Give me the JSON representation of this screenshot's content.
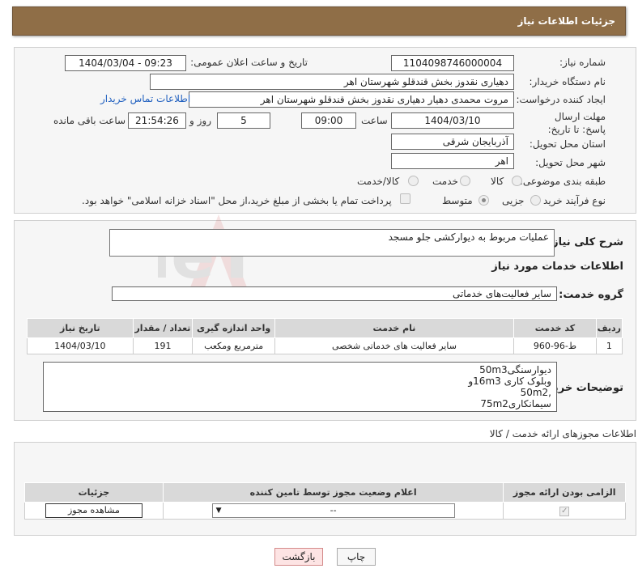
{
  "header": {
    "title": "جزئیات اطلاعات نیاز"
  },
  "form": {
    "need_number_label": "شماره نیاز:",
    "need_number": "1104098746000004",
    "announce_label": "تاریخ و ساعت اعلان عمومی:",
    "announce_value": "1404/03/04 - 09:23",
    "buyer_org_label": "نام دستگاه خریدار:",
    "buyer_org": "دهیاری نقدوز بخش قندقلو شهرستان اهر",
    "requester_label": "ایجاد کننده درخواست:",
    "requester": "مروت محمدی دهیار دهیاری نقدوز بخش قندقلو شهرستان اهر",
    "contact_link": "اطلاعات تماس خریدار",
    "deadline_label": "مهلت ارسال پاسخ: تا تاریخ:",
    "deadline_date": "1404/03/10",
    "time_label": "ساعت",
    "deadline_time": "09:00",
    "days": "5",
    "days_label": "روز و",
    "remaining": "21:54:26",
    "remaining_label": "ساعت باقی مانده",
    "province_label": "استان محل تحویل:",
    "province": "آذربایجان شرقی",
    "city_label": "شهر محل تحویل:",
    "city": "اهر",
    "category_label": "طبقه بندی موضوعی:",
    "category_options": [
      "کالا",
      "خدمت",
      "کالا/خدمت"
    ],
    "process_label": "نوع فرآیند خرید :",
    "process_options": [
      "جزیی",
      "متوسط"
    ],
    "payment_note": "پرداخت تمام یا بخشی از مبلغ خرید،از محل \"اسناد خزانه اسلامی\" خواهد بود."
  },
  "summary": {
    "label": "شرح کلی نیاز:",
    "value": "عملیات مربوط به دیوارکشی جلو مسجد",
    "services_title": "اطلاعات خدمات مورد نیاز",
    "group_label": "گروه خدمت:",
    "group_value": "سایر فعالیت‌های خدماتی"
  },
  "services_table": {
    "headers": [
      "ردیف",
      "کد خدمت",
      "نام خدمت",
      "واحد اندازه گیری",
      "تعداد / مقدار",
      "تاریخ نیاز"
    ],
    "rows": [
      [
        "1",
        "ط-96-960",
        "سایر فعالیت های خدماتی شخصی",
        "مترمربع ومکعب",
        "191",
        "1404/03/10"
      ]
    ]
  },
  "buyer_notes": {
    "label": "توضیحات خریدار:",
    "lines": [
      "دیوارسنگی50m3",
      "وبلوک کاری 16m3و",
      ",50m2",
      "سیمانکاری75m2"
    ]
  },
  "permits": {
    "section_title": "اطلاعات مجوزهای ارائه خدمت / کالا",
    "headers": [
      "الزامی بودن ارائه مجوز",
      "اعلام وضعیت مجوز توسط تامین کننده",
      "جزئیات"
    ],
    "select_value": "--",
    "view_button": "مشاهده مجوز"
  },
  "footer": {
    "print_button": "چاپ",
    "back_button": "بازگشت"
  },
  "watermark": {
    "text": "AriaTender.neT"
  },
  "colors": {
    "header_bg": "#8f6e47",
    "link": "#1f5fbf",
    "back_bg": "#fde4e4"
  }
}
